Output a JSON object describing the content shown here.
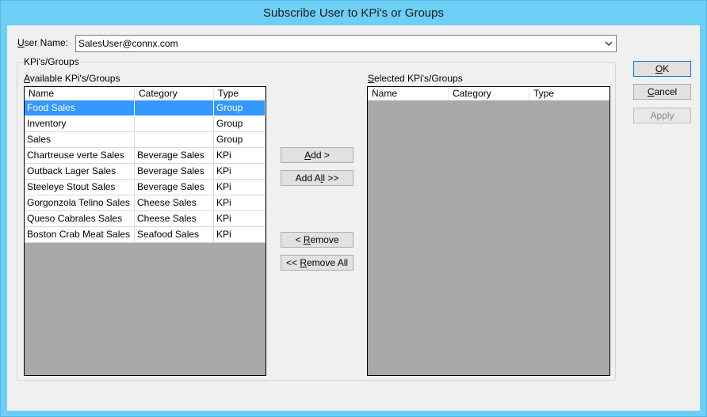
{
  "window": {
    "title": "Subscribe User to KPi's or Groups"
  },
  "user": {
    "label_prefix": "U",
    "label_rest": "ser Name:",
    "value": "SalesUser@connx.com"
  },
  "groupbox": {
    "title": "KPi's/Groups"
  },
  "available": {
    "label_prefix": "A",
    "label_rest": "vailable KPi's/Groups",
    "columns": [
      "Name",
      "Category",
      "Type"
    ],
    "rows": [
      [
        "Food Sales",
        "",
        "Group"
      ],
      [
        "Inventory",
        "",
        "Group"
      ],
      [
        "Sales",
        "",
        "Group"
      ],
      [
        "Chartreuse verte Sales",
        "Beverage Sales",
        "KPi"
      ],
      [
        "Outback Lager Sales",
        "Beverage Sales",
        "KPi"
      ],
      [
        "Steeleye Stout Sales",
        "Beverage Sales",
        "KPi"
      ],
      [
        "Gorgonzola Telino Sales",
        "Cheese Sales",
        "KPi"
      ],
      [
        "Queso Cabrales Sales",
        "Cheese Sales",
        "KPi"
      ],
      [
        "Boston Crab Meat Sales",
        "Seafood Sales",
        "KPi"
      ]
    ],
    "selected_row": 0
  },
  "selected": {
    "label_prefix": "S",
    "label_rest": "elected KPi's/Groups",
    "columns": [
      "Name",
      "Category",
      "Type"
    ]
  },
  "buttons": {
    "add": {
      "pre": "",
      "key": "A",
      "post": "dd >"
    },
    "add_all": {
      "pre": "Add A",
      "key": "l",
      "post": "l >>"
    },
    "remove": {
      "pre": "< ",
      "key": "R",
      "post": "emove"
    },
    "remove_all": {
      "pre": "<< ",
      "key": "R",
      "post": "emove All"
    },
    "ok": {
      "pre": "",
      "key": "O",
      "post": "K"
    },
    "cancel": {
      "pre": "",
      "key": "C",
      "post": "ancel"
    },
    "apply": {
      "pre": "Apply",
      "key": "",
      "post": ""
    }
  },
  "icons": {
    "combo_arrow": "chevron-down-icon"
  },
  "colors": {
    "titlebar": "#6dcff6",
    "selection": "#3399ff",
    "list_bg": "#a9a9a9"
  }
}
